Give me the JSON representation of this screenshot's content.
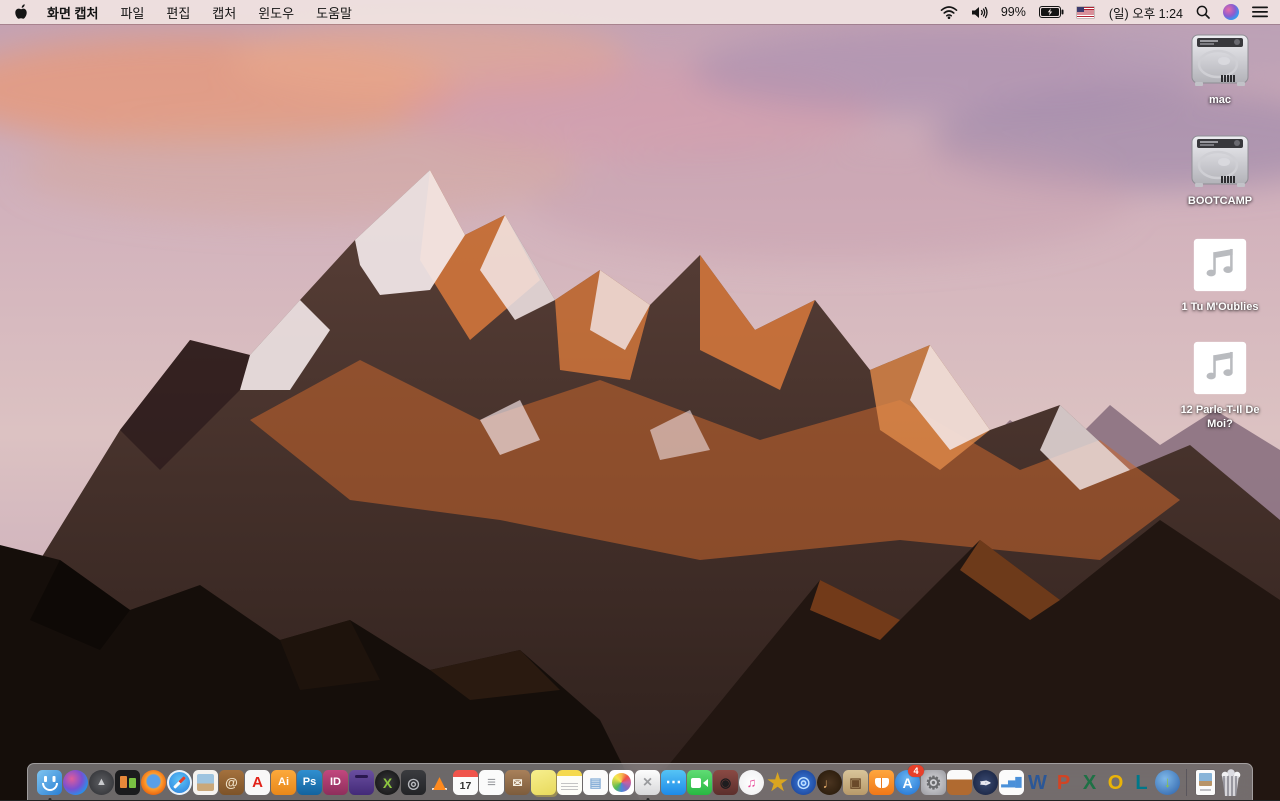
{
  "menu_bar": {
    "app_name": "화면 캡처",
    "menus": [
      "파일",
      "편집",
      "캡처",
      "윈도우",
      "도움말"
    ],
    "battery_percent": "99%",
    "clock": "(일) 오후 1:24",
    "status_icons": [
      "wifi-icon",
      "volume-icon",
      "battery-charging-icon",
      "input-source-us-flag-icon",
      "spotlight-search-icon",
      "siri-icon",
      "notification-center-icon"
    ]
  },
  "desktop": {
    "icons": [
      {
        "label": "mac",
        "type": "hard-drive"
      },
      {
        "label": "BOOTCAMP",
        "type": "hard-drive"
      },
      {
        "label": "1 Tu M'Oublies",
        "type": "audio-file"
      },
      {
        "label": "12 Parle-T-Il De Moi?",
        "type": "audio-file"
      }
    ]
  },
  "dock": {
    "badge_color": "#e8402a",
    "apps": [
      {
        "n": "finder",
        "g": "",
        "bg": "linear-gradient(135deg,#7fc4f0,#2a7fd4)",
        "shape": "square",
        "running": true
      },
      {
        "n": "siri",
        "g": "",
        "bg": "radial-gradient(circle at 35% 35%,#e05c9a,#7a4fd0 45%,#2a8fe8 75%,#1a3a6a)",
        "shape": "circle"
      },
      {
        "n": "launchpad",
        "g": "▲",
        "fg": "#c9cacd",
        "fs": 11,
        "bg": "radial-gradient(circle,#5c5d61,#2c2d31)",
        "shape": "circle"
      },
      {
        "n": "screens",
        "g": "",
        "bg": "#1b1b1d",
        "shape": "square"
      },
      {
        "n": "firefox",
        "g": "",
        "bg": "radial-gradient(circle at 50% 45%,#5a9fe8 0 34%,#ff9d2e 42%,#e8600a 78%)",
        "shape": "circle"
      },
      {
        "n": "safari",
        "g": "",
        "bg": "radial-gradient(circle at 50% 40%,#5ec4f7,#1f72d8)",
        "shape": "circle"
      },
      {
        "n": "preview",
        "g": "",
        "bg": "#f5f3f0",
        "shape": "square"
      },
      {
        "n": "contacts-book",
        "g": "@",
        "fg": "#f0e2c8",
        "fs": 13,
        "bg": "linear-gradient(#a4713d,#7d5328)",
        "shape": "square"
      },
      {
        "n": "acrobat-reader",
        "g": "A",
        "fg": "#e2231a",
        "fs": 15,
        "bg": "#f8f8f8",
        "shape": "square"
      },
      {
        "n": "illustrator",
        "g": "Ai",
        "fg": "#ffffff",
        "fs": 11,
        "bg": "linear-gradient(#fca93c,#e8881a)",
        "shape": "square"
      },
      {
        "n": "photoshop",
        "g": "Ps",
        "fg": "#ffffff",
        "fs": 11,
        "bg": "linear-gradient(#2f8fd0,#13639e)",
        "shape": "square"
      },
      {
        "n": "indesign",
        "g": "ID",
        "fg": "#ffffff",
        "fs": 11,
        "bg": "linear-gradient(#c2487e,#8e2f5c)",
        "shape": "square"
      },
      {
        "n": "toast",
        "g": "",
        "bg": "linear-gradient(#6a4fa0,#432a78)",
        "shape": "square"
      },
      {
        "n": "green-x",
        "g": "X",
        "fg": "#8dc63f",
        "fs": 14,
        "bg": "radial-gradient(circle,#3a3a3c,#0f0f10)",
        "shape": "circle"
      },
      {
        "n": "black-drive",
        "g": "◎",
        "fg": "#b8babf",
        "fs": 14,
        "bg": "linear-gradient(#3a3b3f,#232427)",
        "shape": "square"
      },
      {
        "n": "vlc",
        "g": "▲",
        "fg": "#ff8a1e",
        "fs": 22,
        "bg": "none",
        "shape": "none"
      },
      {
        "n": "calendar",
        "g": "17",
        "fg": "#333333",
        "bg": "linear-gradient(#f0544c 0 28%,#fbfbfb 28%)",
        "shape": "square"
      },
      {
        "n": "reminders",
        "g": "≡",
        "fg": "#9a9ca0",
        "fs": 15,
        "bg": "#fbfbfb",
        "shape": "square"
      },
      {
        "n": "archive-box",
        "g": "✉",
        "fg": "#f5efe2",
        "fs": 12,
        "bg": "linear-gradient(#a8805a,#7d5c3c)",
        "shape": "square"
      },
      {
        "n": "stickies",
        "g": "",
        "bg": "linear-gradient(160deg,#f7ef8e,#e8d95c)",
        "shape": "square"
      },
      {
        "n": "notes",
        "g": "",
        "bg": "linear-gradient(#f5d94e 0 24%,#fdfdf8 24%)",
        "shape": "square"
      },
      {
        "n": "document-seal",
        "g": "▤",
        "fg": "#8ab0d8",
        "fs": 13,
        "bg": "#fbfbfb",
        "shape": "square"
      },
      {
        "n": "photos",
        "g": "",
        "bg": "#ffffff",
        "shape": "square"
      },
      {
        "n": "generic-app",
        "g": "×",
        "fg": "#9a9b9e",
        "fs": 16,
        "bg": "linear-gradient(#fdfdfd,#d8d8da)",
        "shape": "square",
        "running": true
      },
      {
        "n": "messages",
        "g": "⋯",
        "fg": "#ffffff",
        "fs": 16,
        "bg": "linear-gradient(#55c4f5,#1e8ae8)",
        "shape": "square"
      },
      {
        "n": "facetime",
        "g": "",
        "bg": "linear-gradient(#5fdc74,#28b842)",
        "shape": "square"
      },
      {
        "n": "photo-booth",
        "g": "◉",
        "fg": "#1d1d1f",
        "fs": 13,
        "bg": "linear-gradient(#8a4a44,#5c2f2c)",
        "shape": "square"
      },
      {
        "n": "itunes",
        "g": "♫",
        "fg": "#e8489a",
        "fs": 13,
        "bg": "radial-gradient(circle,#ffffff,#eeeef0)",
        "shape": "circle"
      },
      {
        "n": "star",
        "g": "★",
        "fg": "#d9a520",
        "fs": 23,
        "bg": "none",
        "shape": "none"
      },
      {
        "n": "blue-disc",
        "g": "◎",
        "fg": "#bfe0ff",
        "fs": 15,
        "bg": "radial-gradient(circle,#3b7de0,#173a8a)",
        "shape": "circle"
      },
      {
        "n": "garageband",
        "g": "♩",
        "fg": "#e0a868",
        "fs": 14,
        "bg": "radial-gradient(circle,#4a3420,#241708)",
        "shape": "circle"
      },
      {
        "n": "scrapbook",
        "g": "▣",
        "fg": "#6a4a2a",
        "fs": 13,
        "bg": "linear-gradient(#d8c49a,#b89a6a)",
        "shape": "square"
      },
      {
        "n": "ibooks",
        "g": "",
        "bg": "linear-gradient(#ffa63e,#f07818)",
        "shape": "square"
      },
      {
        "n": "app-store",
        "g": "A",
        "fg": "#ffffff",
        "fs": 14,
        "bg": "radial-gradient(circle at 50% 35%,#6ab6f2,#1d6fd2)",
        "shape": "circle",
        "badge": "4"
      },
      {
        "n": "system-preferences",
        "g": "⚙",
        "fg": "#6a6b6e",
        "fs": 18,
        "bg": "radial-gradient(circle,#d8d8dc,#9a9aa0)",
        "shape": "square"
      },
      {
        "n": "keynote",
        "g": "",
        "bg": "linear-gradient(#fafafa 0 38%,#b06a30 38%)",
        "shape": "square"
      },
      {
        "n": "pages-09",
        "g": "✒",
        "fg": "#e8e8f0",
        "fs": 14,
        "bg": "radial-gradient(circle,#3a4a72,#141e3a)",
        "shape": "circle"
      },
      {
        "n": "numbers-09",
        "g": "▂▅█",
        "fg": "#4a90d9",
        "fs": 9,
        "bg": "#fbfbfb",
        "shape": "square"
      },
      {
        "n": "word",
        "g": "W",
        "fg": "#2b5797",
        "fs": 20,
        "bg": "none",
        "shape": "none"
      },
      {
        "n": "powerpoint",
        "g": "P",
        "fg": "#d14424",
        "fs": 20,
        "bg": "none",
        "shape": "none"
      },
      {
        "n": "excel",
        "g": "X",
        "fg": "#1e7145",
        "fs": 20,
        "bg": "none",
        "shape": "none"
      },
      {
        "n": "outlook",
        "g": "O",
        "fg": "#eab308",
        "fs": 20,
        "bg": "none",
        "shape": "none"
      },
      {
        "n": "lync",
        "g": "L",
        "fg": "#00788a",
        "fs": 20,
        "bg": "none",
        "shape": "none"
      },
      {
        "n": "web-downloader",
        "g": "↓",
        "fg": "#8dc63f",
        "fs": 15,
        "bg": "radial-gradient(circle at 40% 35%,#7fb8e8,#2a5fa8)",
        "shape": "circle"
      }
    ],
    "files": [
      {
        "n": "image-document"
      }
    ],
    "trash_state": "full"
  }
}
